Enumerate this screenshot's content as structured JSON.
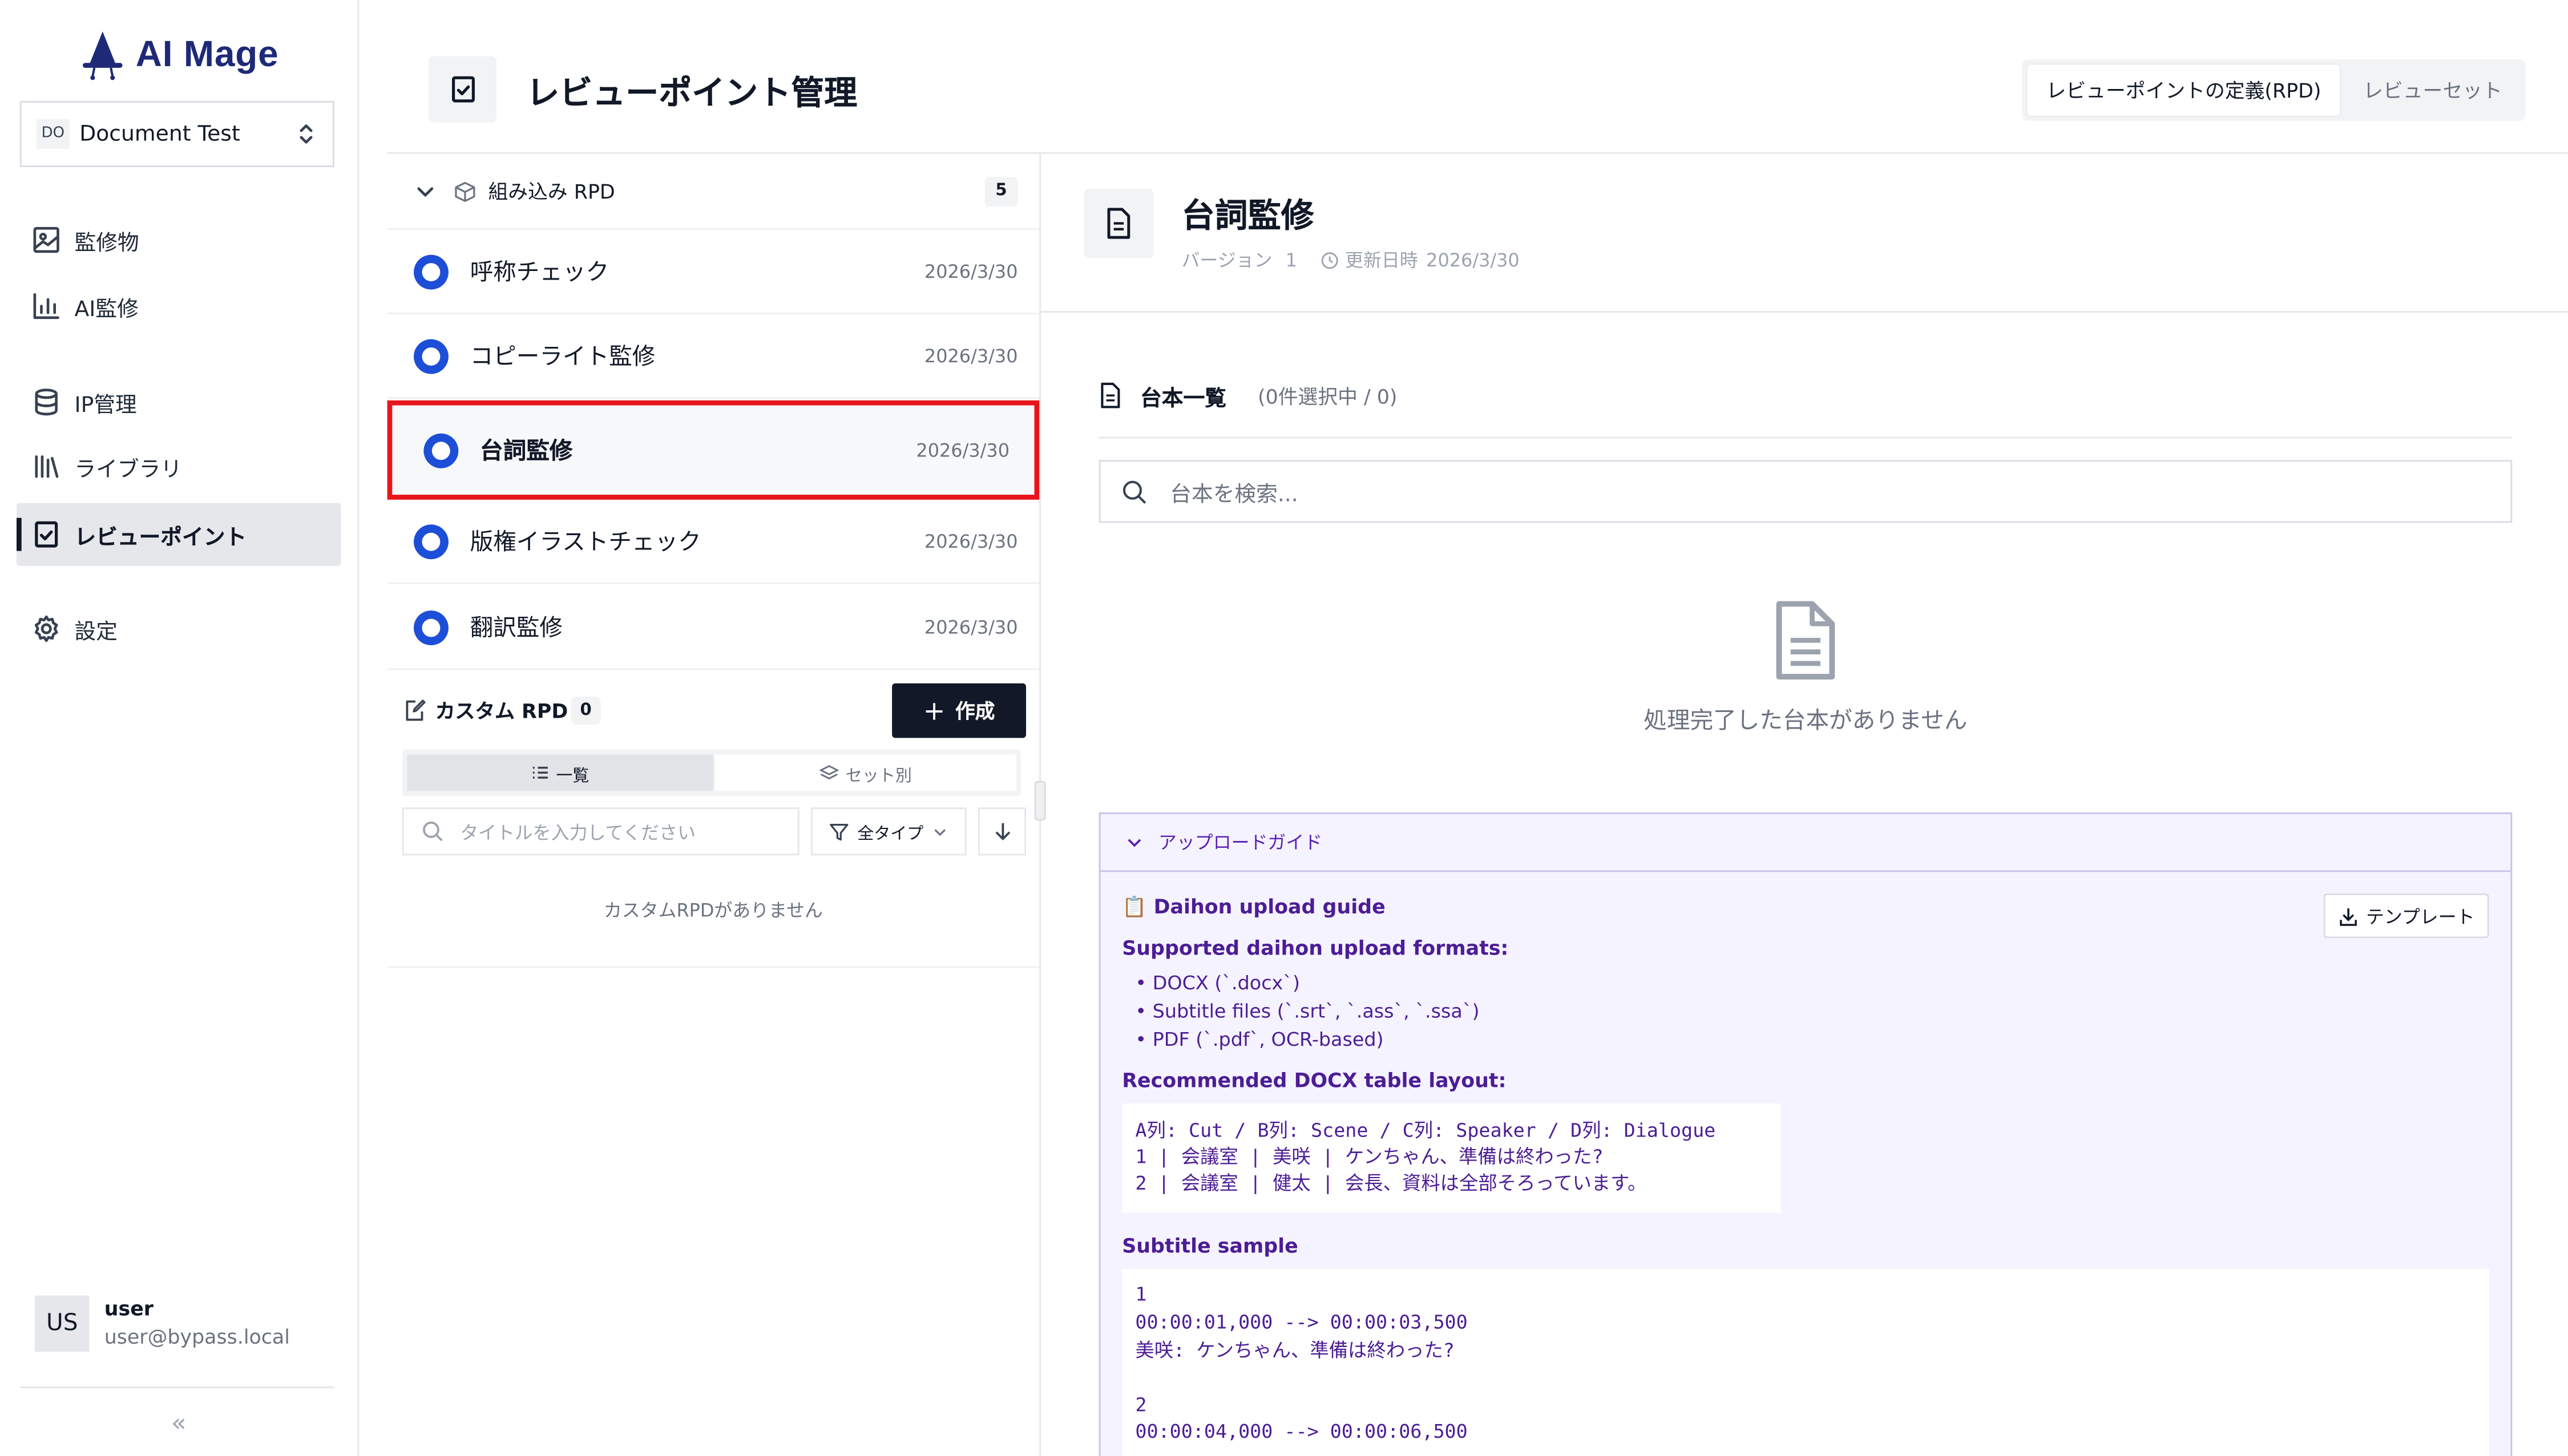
{
  "app": {
    "name": "AI Mage"
  },
  "project": {
    "badge": "DO",
    "name": "Document Test"
  },
  "nav": [
    {
      "label": "監修物"
    },
    {
      "label": "AI監修"
    },
    {
      "label": "IP管理"
    },
    {
      "label": "ライブラリ"
    },
    {
      "label": "レビューポイント",
      "active": true
    },
    {
      "label": "設定"
    }
  ],
  "user": {
    "initials": "US",
    "name": "user",
    "email": "user@bypass.local"
  },
  "collapse_glyph": "«",
  "page": {
    "title": "レビューポイント管理"
  },
  "header_tabs": [
    {
      "label": "レビューポイントの定義(RPD)",
      "selected": true
    },
    {
      "label": "レビューセット",
      "selected": false
    }
  ],
  "builtin": {
    "title": "組み込み RPD",
    "count": "5",
    "items": [
      {
        "name": "呼称チェック",
        "date": "2026/3/30"
      },
      {
        "name": "コピーライト監修",
        "date": "2026/3/30"
      },
      {
        "name": "台詞監修",
        "date": "2026/3/30",
        "selected": true
      },
      {
        "name": "版権イラストチェック",
        "date": "2026/3/30"
      },
      {
        "name": "翻訳監修",
        "date": "2026/3/30"
      }
    ]
  },
  "custom": {
    "title": "カスタム RPD",
    "count": "0",
    "create_label": "作成",
    "view_tabs": [
      {
        "label": "一覧",
        "selected": true
      },
      {
        "label": "セット別",
        "selected": false
      }
    ],
    "search_placeholder": "タイトルを入力してください",
    "type_filter": "全タイプ",
    "empty": "カスタムRPDがありません"
  },
  "detail": {
    "title": "台詞監修",
    "version_label": "バージョン",
    "version": "1",
    "updated_label": "更新日時",
    "updated": "2026/3/30",
    "list_title": "台本一覧",
    "list_count": "(0件選択中 / 0)",
    "search_placeholder": "台本を検索...",
    "empty": "処理完了した台本がありません"
  },
  "guide": {
    "toggle": "アップロードガイド",
    "template_button": "テンプレート",
    "heading": "📋 Daihon upload guide",
    "formats_title": "Supported daihon upload formats:",
    "formats": [
      "• DOCX (`.docx`)",
      "• Subtitle files (`.srt`, `.ass`, `.ssa`)",
      "• PDF (`.pdf`, OCR-based)"
    ],
    "layout_title": "Recommended DOCX table layout:",
    "layout_code": [
      "A列: Cut / B列: Scene / C列: Speaker / D列: Dialogue",
      "1 | 会議室 | 美咲 | ケンちゃん、準備は終わった?",
      "2 | 会議室 | 健太 | 会長、資料は全部そろっています。"
    ],
    "subtitle_title": "Subtitle sample",
    "subtitle_code": [
      "1",
      "00:00:01,000 --> 00:00:03,500",
      "美咲: ケンちゃん、準備は終わった?",
      "",
      "2",
      "00:00:04,000 --> 00:00:06,500"
    ]
  },
  "colors": {
    "accent_blue": "#1d4ed8",
    "brand_navy": "#1e2a78",
    "guide_purple": "#4c1d95",
    "highlight_red": "#e8151b",
    "dark_button": "#111827"
  }
}
